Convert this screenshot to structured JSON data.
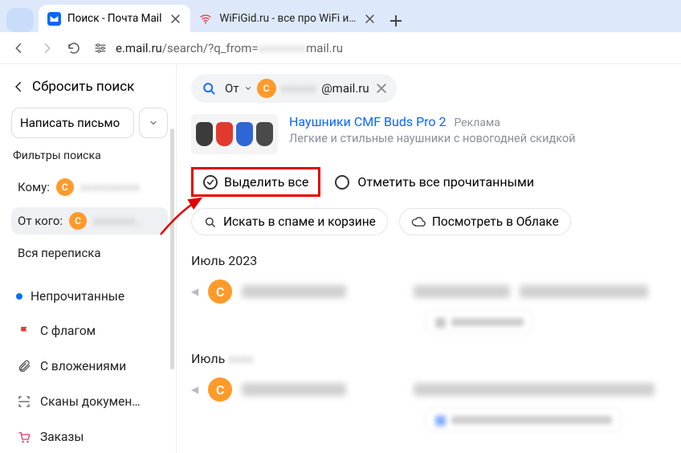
{
  "browser": {
    "tabs": [
      {
        "title": "Поиск - Почта Mail",
        "active": true
      },
      {
        "title": "WiFiGid.ru - все про WiFi и бе…",
        "active": false
      }
    ],
    "url_prefix": "e.mail.ru",
    "url_path_visible": "/search/?q_from=",
    "url_suffix": "mail.ru"
  },
  "sidebar": {
    "reset_search": "Сбросить поиск",
    "compose": "Написать письмо",
    "filters_title": "Фильтры поиска",
    "to_label": "Кому:",
    "from_label": "От кого:",
    "all_thread": "Вся переписка",
    "items": {
      "unread": "Непрочитанные",
      "flagged": "С флагом",
      "attachments": "С вложениями",
      "scans": "Сканы докумен…",
      "orders": "Заказы"
    },
    "avatar_letter": "С"
  },
  "search": {
    "from_prefix": "От",
    "email_suffix": "@mail.ru"
  },
  "ad": {
    "title": "Наушники CMF Buds Pro 2",
    "tag": "Реклама",
    "subtitle": "Легкие и стильные наушники с новогодней скидкой",
    "colors": [
      "#3b3b3b",
      "#e13a2f",
      "#2f66d6",
      "#4a4a4a"
    ]
  },
  "toolbar": {
    "select_all": "Выделить все",
    "mark_read": "Отметить все прочитанными",
    "search_spam": "Искать в спаме и корзине",
    "view_cloud": "Посмотреть в Облаке"
  },
  "list": {
    "month1": "Июль 2023",
    "month2_prefix": "Июль",
    "avatar_letter": "С"
  }
}
